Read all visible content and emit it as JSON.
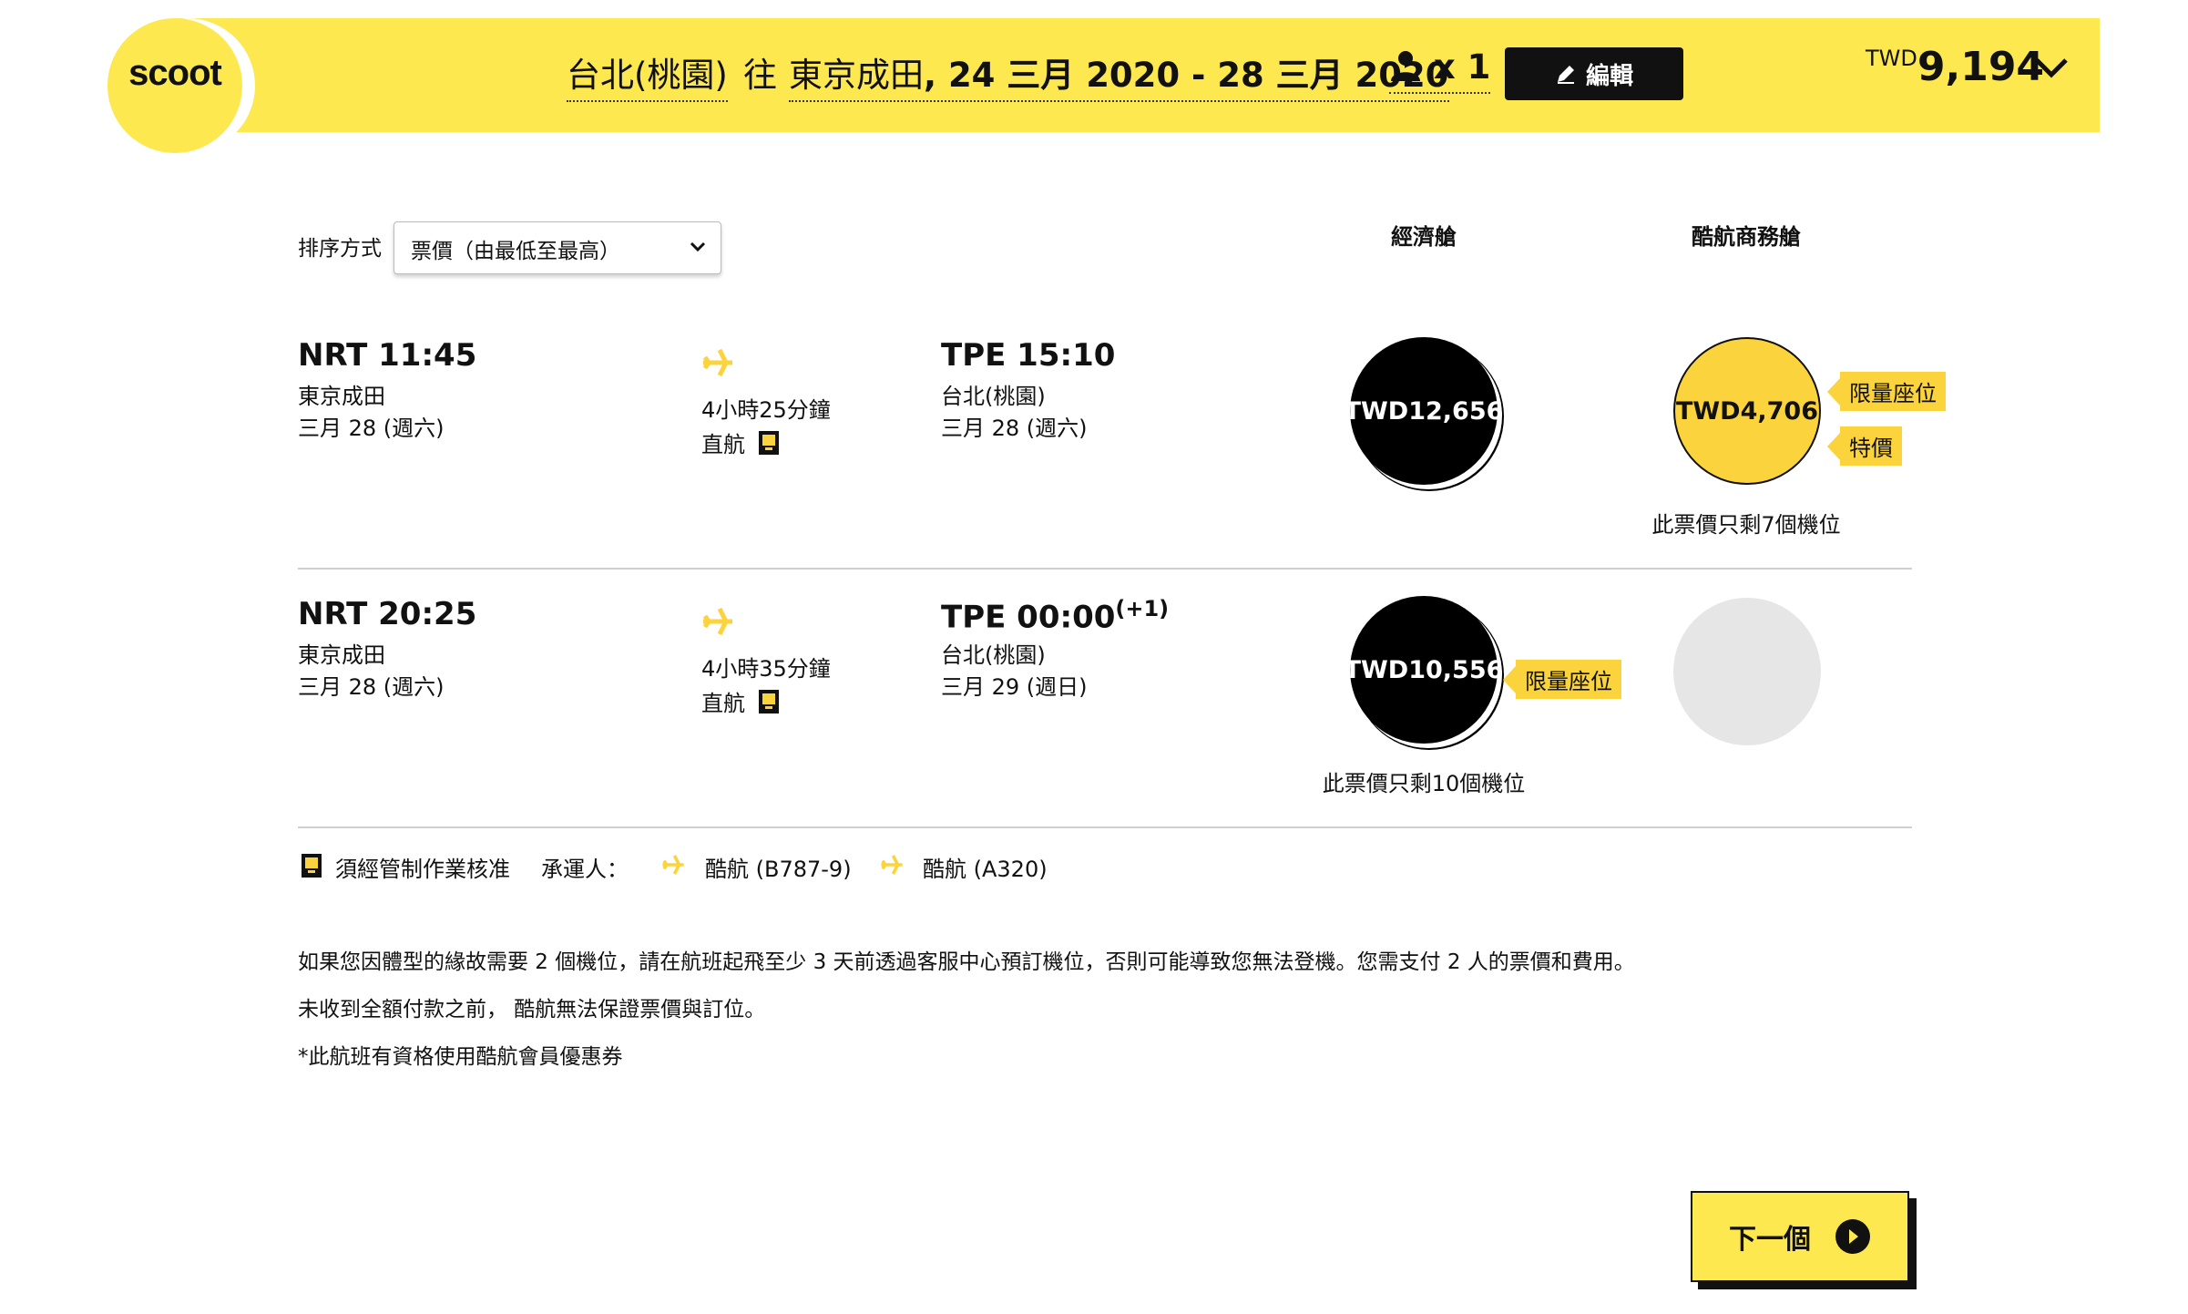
{
  "header": {
    "logo": "scoot",
    "origin": "台北(桃園)",
    "to_word": "往",
    "destination": "東京成田",
    "dates": "24 三月 2020 - 28 三月 2020",
    "passengers": "x 1",
    "edit_label": "編輯",
    "total_currency": "TWD",
    "total_amount": "9,194"
  },
  "sort": {
    "label": "排序方式",
    "selected": "票價（由最低至最高）"
  },
  "columns": {
    "economy": "經濟艙",
    "business": "酷航商務艙"
  },
  "flights": [
    {
      "dep_time": "NRT 11:45",
      "dep_city": "東京成田",
      "dep_date": "三月 28 (週六)",
      "duration": "4小時25分鐘",
      "stops": "直航",
      "arr_time": "TPE 15:10",
      "arr_next_day": "",
      "arr_city": "台北(桃園)",
      "arr_date": "三月 28 (週六)",
      "economy_fare": "TWD12,656",
      "business_fare": "TWD4,706",
      "business_tags": [
        "限量座位",
        "特價"
      ],
      "seats_note": "此票價只剩7個機位"
    },
    {
      "dep_time": "NRT 20:25",
      "dep_city": "東京成田",
      "dep_date": "三月 28 (週六)",
      "duration": "4小時35分鐘",
      "stops": "直航",
      "arr_time": "TPE 00:00",
      "arr_next_day": "(+1)",
      "arr_city": "台北(桃園)",
      "arr_date": "三月 29 (週日)",
      "economy_fare": "TWD10,556",
      "economy_tag": "限量座位",
      "seats_note": "此票價只剩10個機位"
    }
  ],
  "legend": {
    "approval": "須經管制作業核准",
    "carrier_label": "承運人：",
    "carrier1": "酷航 (B787-9)",
    "carrier2": "酷航 (A320)"
  },
  "notes": [
    "如果您因體型的緣故需要 2 個機位，請在航班起飛至少 3 天前透過客服中心預訂機位，否則可能導致您無法登機。您需支付 2 人的票價和費用。",
    "未收到全額付款之前， 酷航無法保證票價與訂位。",
    "*此航班有資格使用酷航會員優惠券"
  ],
  "next_label": "下一個",
  "colors": {
    "brand_yellow": "#fde84f",
    "tag_yellow": "#fbd33c",
    "dark": "#111111",
    "empty_fare": "#e6e6e6"
  },
  "icons": [
    "user-icon",
    "pencil-icon",
    "chevron-down-icon",
    "plane-icon",
    "document-icon",
    "arrow-right-circle-icon"
  ]
}
